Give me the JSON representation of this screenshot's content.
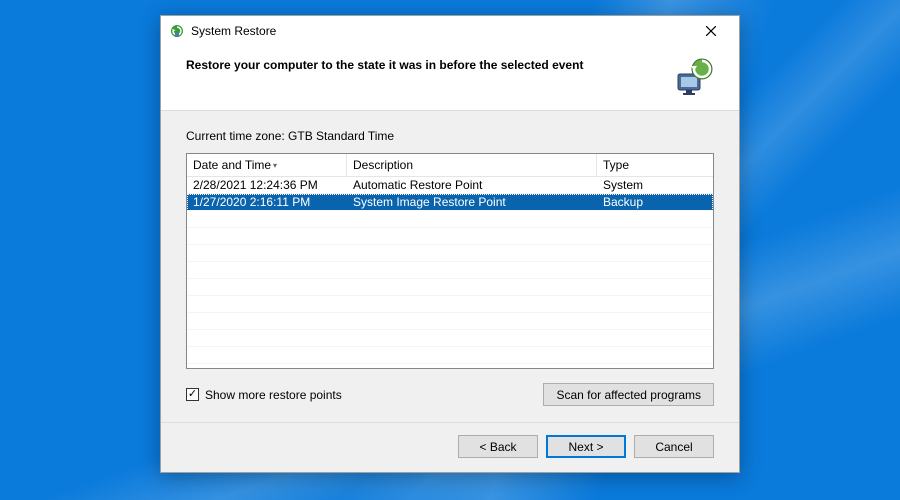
{
  "window": {
    "title": "System Restore"
  },
  "header": {
    "heading": "Restore your computer to the state it was in before the selected event"
  },
  "body": {
    "timezone_label": "Current time zone: GTB Standard Time",
    "columns": {
      "date": "Date and Time",
      "description": "Description",
      "type": "Type"
    },
    "rows": [
      {
        "date": "2/28/2021 12:24:36 PM",
        "description": "Automatic Restore Point",
        "type": "System",
        "selected": false
      },
      {
        "date": "1/27/2020 2:16:11 PM",
        "description": "System Image Restore Point",
        "type": "Backup",
        "selected": true
      }
    ],
    "checkbox": {
      "checked": true,
      "label": "Show more restore points"
    },
    "scan_button": "Scan for affected programs"
  },
  "footer": {
    "back": "< Back",
    "next": "Next >",
    "cancel": "Cancel"
  }
}
